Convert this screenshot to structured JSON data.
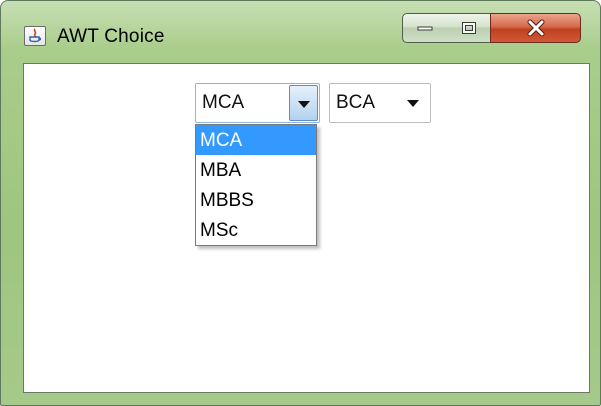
{
  "window": {
    "title": "AWT Choice"
  },
  "choices": [
    {
      "selected": "MCA",
      "options": [
        "MCA",
        "MBA",
        "MBBS",
        "MSc"
      ],
      "highlighted": "MCA",
      "open": true
    },
    {
      "selected": "BCA"
    }
  ],
  "colors": {
    "selection": "#3399ff",
    "close_button": "#c7462a",
    "frame": "#a5c98a"
  },
  "icons": [
    "java-app-icon",
    "minimize-icon",
    "maximize-icon",
    "close-icon",
    "chevron-down-icon"
  ]
}
